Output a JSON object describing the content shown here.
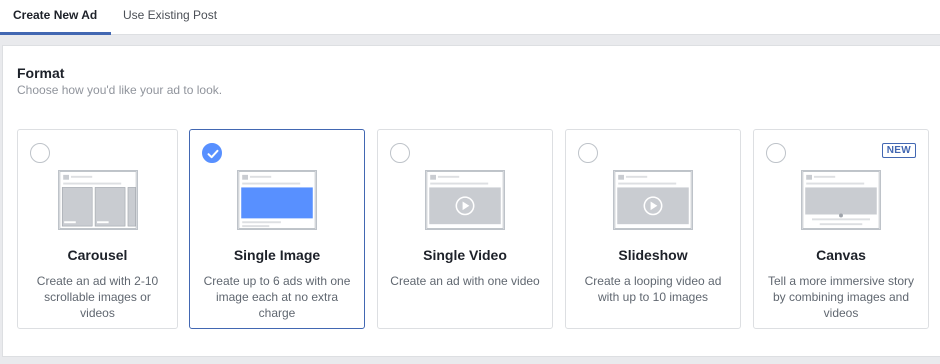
{
  "tabs": {
    "create_new_ad": "Create New Ad",
    "use_existing_post": "Use Existing Post"
  },
  "format": {
    "title": "Format",
    "subtitle": "Choose how you'd like your ad to look."
  },
  "cards": [
    {
      "title": "Carousel",
      "description": "Create an ad with 2-10 scrollable images or videos",
      "selected": false,
      "icon": "carousel-preview-icon"
    },
    {
      "title": "Single Image",
      "description": "Create up to 6 ads with one image each at no extra charge",
      "selected": true,
      "icon": "single-image-preview-icon"
    },
    {
      "title": "Single Video",
      "description": "Create an ad with one video",
      "selected": false,
      "icon": "single-video-preview-icon"
    },
    {
      "title": "Slideshow",
      "description": "Create a looping video ad with up to 10 images",
      "selected": false,
      "icon": "slideshow-preview-icon"
    },
    {
      "title": "Canvas",
      "description": "Tell a more immersive story by combining images and videos",
      "selected": false,
      "badge": "NEW",
      "icon": "canvas-preview-icon"
    }
  ],
  "colors": {
    "accent": "#4267b2",
    "selected_radio": "#5890ff",
    "image_fill_selected": "#5890ff",
    "image_fill": "#c9ccd1"
  }
}
